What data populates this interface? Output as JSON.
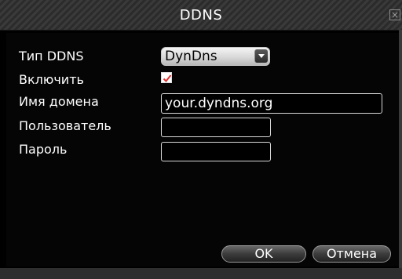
{
  "window": {
    "title": "DDNS",
    "close_symbol": "×"
  },
  "form": {
    "ddns_type": {
      "label": "Тип DDNS",
      "value": "DynDns"
    },
    "enable": {
      "label": "Включить",
      "checked": true
    },
    "domain": {
      "label": "Имя домена",
      "value": "your.dyndns.org"
    },
    "user": {
      "label": "Пользователь",
      "value": ""
    },
    "password": {
      "label": "Пароль",
      "value": ""
    }
  },
  "buttons": {
    "ok_label": "OK",
    "cancel_label": "Отмена"
  },
  "colors": {
    "checkmark": "#e03030",
    "text": "#ffffff",
    "background": "#000000"
  },
  "icons": {
    "close": "close-icon",
    "dropdown": "chevron-down-icon",
    "check": "checkmark-icon"
  }
}
